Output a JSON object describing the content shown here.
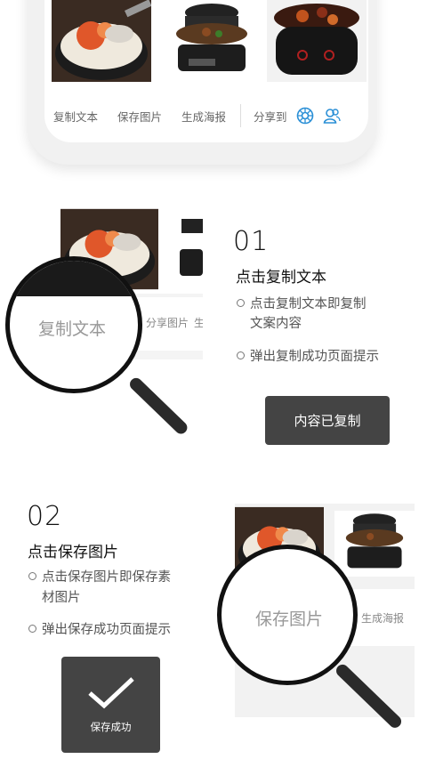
{
  "top_bar": {
    "actions": [
      "复制文本",
      "保存图片",
      "生成海报"
    ],
    "share_label": "分享到",
    "share_icons": [
      "moments-icon",
      "contacts-icon"
    ]
  },
  "step1": {
    "number": "01",
    "title": "点击复制文本",
    "bullets": [
      "点击复制文本即复制",
      "文案内容",
      "弹出复制成功页面提示"
    ],
    "magnified_label": "复制文本",
    "side_label": "分享图片",
    "side_label2": "生",
    "toast": "内容已复制"
  },
  "step2": {
    "number": "02",
    "title": "点击保存图片",
    "bullets": [
      "点击保存图片即保存素",
      "材图片",
      "弹出保存成功页面提示"
    ],
    "magnified_label": "保存图片",
    "side_label": "生成海报",
    "toast_icon": "checkmark-icon",
    "toast": "保存成功"
  },
  "colors": {
    "accent": "#2a8fd6",
    "toast_bg": "#444444"
  }
}
